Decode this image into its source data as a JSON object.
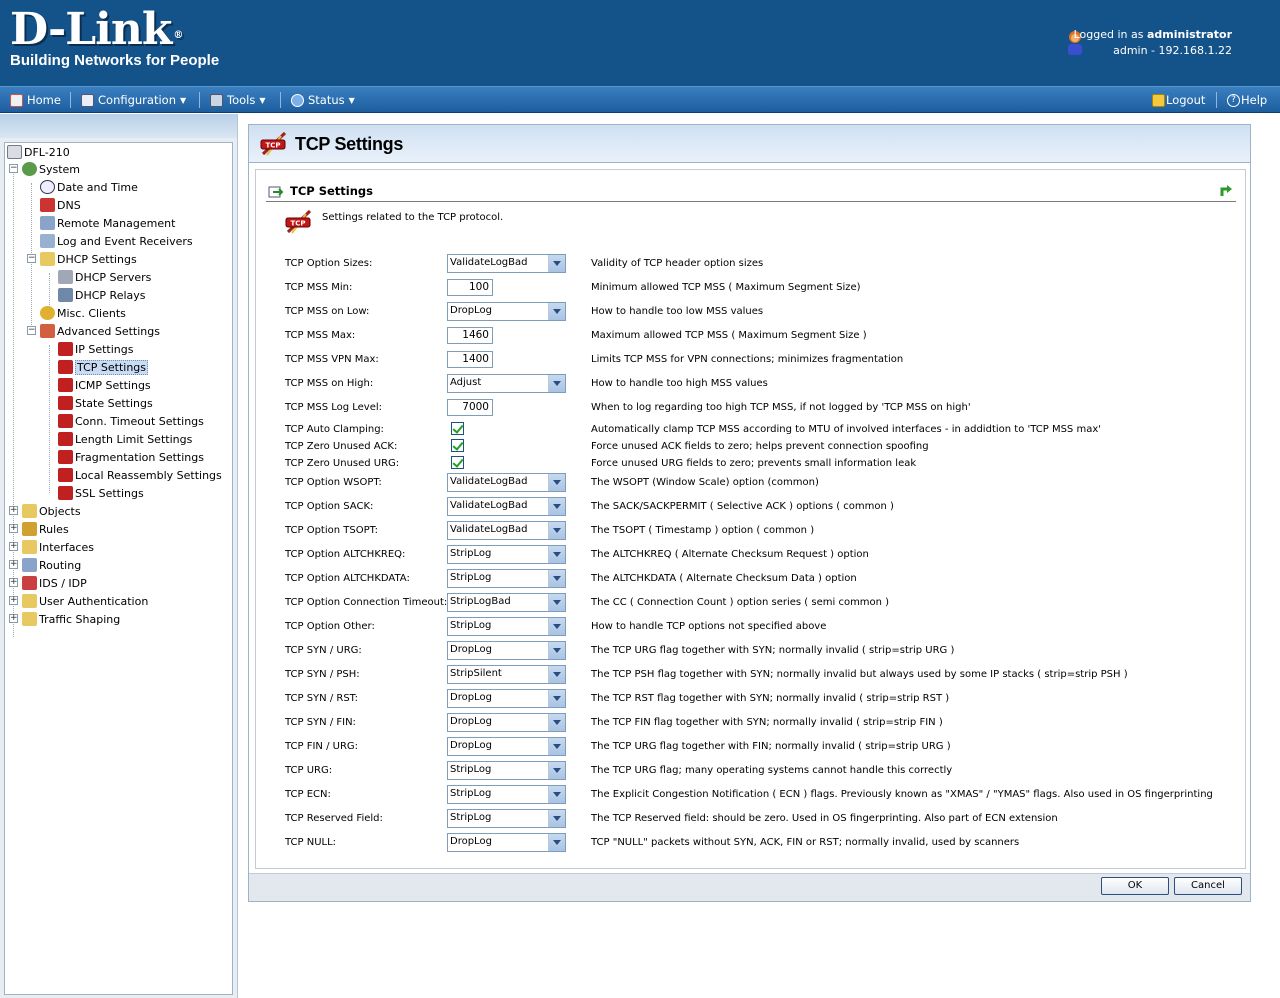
{
  "header": {
    "logo_text": "D-Link",
    "logo_mark": "®",
    "tagline": "Building Networks for People",
    "logged_in_prefix": "Logged in as ",
    "username": "administrator",
    "session": "admin - 192.168.1.22"
  },
  "menu": {
    "home": "Home",
    "configuration": "Configuration",
    "tools": "Tools",
    "status": "Status",
    "logout": "Logout",
    "help": "Help"
  },
  "tree": {
    "root": "DFL-210",
    "system": "System",
    "date_time": "Date and Time",
    "dns": "DNS",
    "remote_mgmt": "Remote Management",
    "log_receivers": "Log and Event Receivers",
    "dhcp_settings": "DHCP Settings",
    "dhcp_servers": "DHCP Servers",
    "dhcp_relays": "DHCP Relays",
    "misc_clients": "Misc. Clients",
    "advanced": "Advanced Settings",
    "ip_settings": "IP Settings",
    "tcp_settings": "TCP Settings",
    "icmp_settings": "ICMP Settings",
    "state_settings": "State Settings",
    "conn_timeout": "Conn. Timeout Settings",
    "length_limit": "Length Limit Settings",
    "fragmentation": "Fragmentation Settings",
    "local_reassembly": "Local Reassembly Settings",
    "ssl_settings": "SSL Settings",
    "objects": "Objects",
    "rules": "Rules",
    "interfaces": "Interfaces",
    "routing": "Routing",
    "ids_idp": "IDS / IDP",
    "user_auth": "User Authentication",
    "traffic_shaping": "Traffic Shaping"
  },
  "page": {
    "title": "TCP Settings",
    "section_title": "TCP Settings",
    "description": "Settings related to the TCP protocol.",
    "ok": "OK",
    "cancel": "Cancel",
    "icon_text": "TCP"
  },
  "rows": [
    {
      "label": "TCP Option Sizes:",
      "type": "select",
      "value": "ValidateLogBad",
      "help": "Validity of TCP header option sizes"
    },
    {
      "label": "TCP MSS Min:",
      "type": "text",
      "value": "100",
      "help": "Minimum allowed TCP MSS ( Maximum Segment Size)"
    },
    {
      "label": "TCP MSS on Low:",
      "type": "select",
      "value": "DropLog",
      "help": "How to handle too low MSS values"
    },
    {
      "label": "TCP MSS Max:",
      "type": "text",
      "value": "1460",
      "help": "Maximum allowed TCP MSS ( Maximum Segment Size )"
    },
    {
      "label": "TCP MSS VPN Max:",
      "type": "text",
      "value": "1400",
      "help": "Limits TCP MSS for VPN connections; minimizes fragmentation"
    },
    {
      "label": "TCP MSS on High:",
      "type": "select",
      "value": "Adjust",
      "help": "How to handle too high MSS values"
    },
    {
      "label": "TCP MSS Log Level:",
      "type": "text",
      "value": "7000",
      "help": "When to log regarding too high TCP MSS, if not logged by 'TCP MSS on high'"
    },
    {
      "label": "TCP Auto Clamping:",
      "type": "check",
      "value": "",
      "help": "Automatically clamp TCP MSS according to MTU of involved interfaces - in addidtion to 'TCP MSS max'"
    },
    {
      "label": "TCP Zero Unused ACK:",
      "type": "check",
      "value": "",
      "help": "Force unused ACK fields to zero; helps prevent connection spoofing"
    },
    {
      "label": "TCP Zero Unused URG:",
      "type": "check",
      "value": "",
      "help": "Force unused URG fields to zero; prevents small information leak"
    },
    {
      "label": "TCP Option WSOPT:",
      "type": "select",
      "value": "ValidateLogBad",
      "help": "The WSOPT (Window Scale) option (common)"
    },
    {
      "label": "TCP Option SACK:",
      "type": "select",
      "value": "ValidateLogBad",
      "help": "The SACK/SACKPERMIT ( Selective ACK ) options ( common )"
    },
    {
      "label": "TCP Option TSOPT:",
      "type": "select",
      "value": "ValidateLogBad",
      "help": "The TSOPT ( Timestamp ) option ( common )"
    },
    {
      "label": "TCP Option ALTCHKREQ:",
      "type": "select",
      "value": "StripLog",
      "help": "The ALTCHKREQ ( Alternate Checksum Request ) option"
    },
    {
      "label": "TCP Option ALTCHKDATA:",
      "type": "select",
      "value": "StripLog",
      "help": "The ALTCHKDATA ( Alternate Checksum Data ) option"
    },
    {
      "label": "TCP Option Connection Timeout:",
      "type": "select",
      "value": "StripLogBad",
      "help": "The CC ( Connection Count ) option series ( semi common )"
    },
    {
      "label": "TCP Option Other:",
      "type": "select",
      "value": "StripLog",
      "help": "How to handle TCP options not specified above"
    },
    {
      "label": "TCP SYN / URG:",
      "type": "select",
      "value": "DropLog",
      "help": "The TCP URG flag together with SYN; normally invalid ( strip=strip URG )"
    },
    {
      "label": "TCP SYN / PSH:",
      "type": "select",
      "value": "StripSilent",
      "help": "The TCP PSH flag together with SYN; normally invalid but always used by some IP stacks ( strip=strip PSH )"
    },
    {
      "label": "TCP SYN / RST:",
      "type": "select",
      "value": "DropLog",
      "help": "The TCP RST flag together with SYN; normally invalid ( strip=strip RST )"
    },
    {
      "label": "TCP SYN / FIN:",
      "type": "select",
      "value": "DropLog",
      "help": "The TCP FIN flag together with SYN; normally invalid ( strip=strip FIN )"
    },
    {
      "label": "TCP FIN / URG:",
      "type": "select",
      "value": "DropLog",
      "help": "The TCP URG flag together with FIN; normally invalid ( strip=strip URG )"
    },
    {
      "label": "TCP URG:",
      "type": "select",
      "value": "StripLog",
      "help": "The TCP URG flag; many operating systems cannot handle this correctly"
    },
    {
      "label": "TCP ECN:",
      "type": "select",
      "value": "StripLog",
      "help": "The Explicit Congestion Notification ( ECN ) flags. Previously known as \"XMAS\" / \"YMAS\" flags. Also used in OS fingerprinting"
    },
    {
      "label": "TCP Reserved Field:",
      "type": "select",
      "value": "StripLog",
      "help": "The TCP Reserved field: should be zero. Used in OS fingerprinting. Also part of ECN extension"
    },
    {
      "label": "TCP NULL:",
      "type": "select",
      "value": "DropLog",
      "help": "TCP \"NULL\" packets without SYN, ACK, FIN or RST; normally invalid, used by scanners"
    }
  ]
}
